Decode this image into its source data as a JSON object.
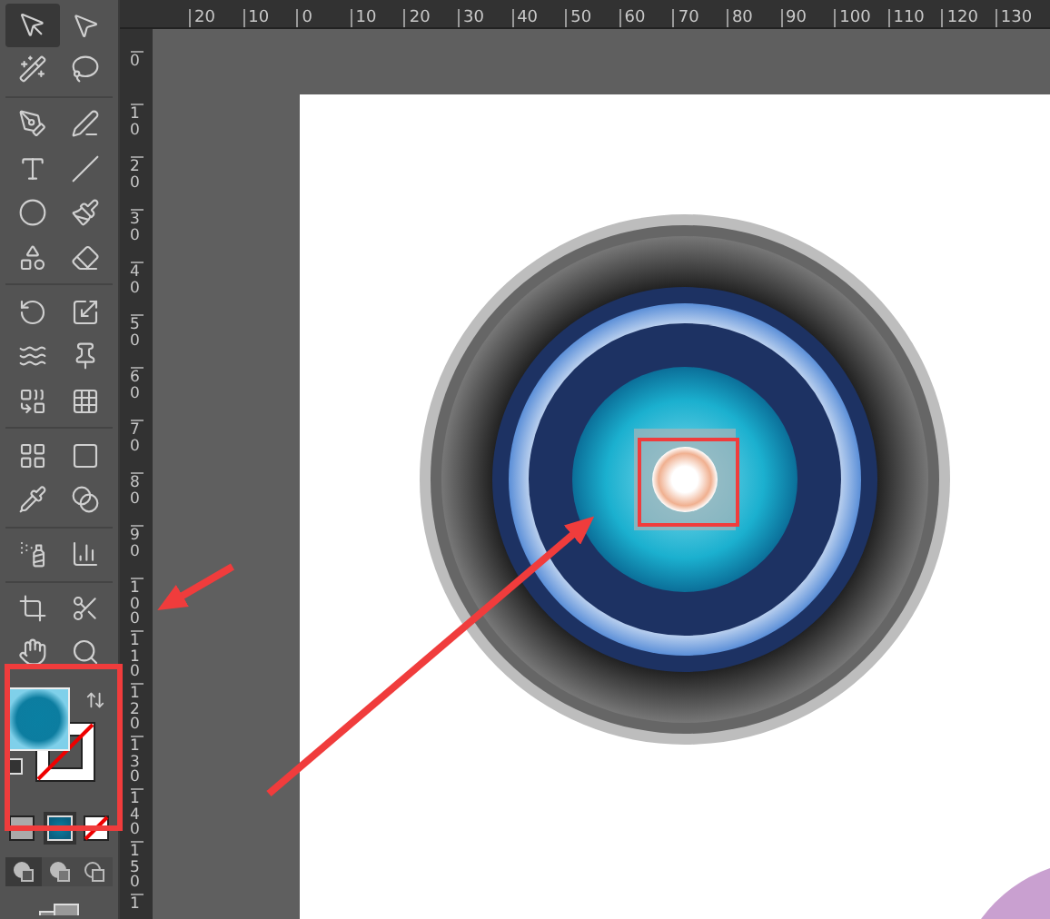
{
  "tools": [
    {
      "kind": "selection",
      "selected": true
    },
    {
      "kind": "direct-selection",
      "selected": false
    },
    {
      "kind": "magic-wand",
      "selected": false
    },
    {
      "kind": "lasso",
      "selected": false
    },
    {
      "kind": "pen",
      "selected": false
    },
    {
      "kind": "curvature",
      "selected": false
    },
    {
      "kind": "type",
      "selected": false
    },
    {
      "kind": "line",
      "selected": false
    },
    {
      "kind": "ellipse",
      "selected": false
    },
    {
      "kind": "brush",
      "selected": false
    },
    {
      "kind": "shaper",
      "selected": false
    },
    {
      "kind": "eraser",
      "selected": false
    },
    {
      "kind": "rotate",
      "selected": false
    },
    {
      "kind": "scale",
      "selected": false
    },
    {
      "kind": "warp",
      "selected": false
    },
    {
      "kind": "pin",
      "selected": false
    },
    {
      "kind": "shape-builder",
      "selected": false
    },
    {
      "kind": "perspective",
      "selected": false
    },
    {
      "kind": "mesh",
      "selected": false
    },
    {
      "kind": "gradient",
      "selected": false
    },
    {
      "kind": "eyedropper",
      "selected": false
    },
    {
      "kind": "blend",
      "selected": false
    },
    {
      "kind": "sprayer",
      "selected": false
    },
    {
      "kind": "graph",
      "selected": false
    },
    {
      "kind": "artboard",
      "selected": false
    },
    {
      "kind": "knife",
      "selected": false
    },
    {
      "kind": "hand",
      "selected": false
    },
    {
      "kind": "zoom",
      "selected": false
    }
  ],
  "color_modes": [
    {
      "kind": "color",
      "selected": false
    },
    {
      "kind": "gradient",
      "selected": true
    },
    {
      "kind": "none",
      "selected": false
    }
  ],
  "draw_modes": [
    {
      "kind": "normal",
      "selected": true
    },
    {
      "kind": "behind",
      "selected": false
    },
    {
      "kind": "inside",
      "selected": false
    }
  ],
  "top_ruler": {
    "labels": [
      "20",
      "10",
      "0",
      "10",
      "20",
      "30",
      "40",
      "50",
      "60",
      "70",
      "80",
      "90",
      "100",
      "110",
      "120",
      "130"
    ]
  },
  "left_ruler": {
    "labels": [
      "0",
      "10",
      "20",
      "30",
      "40",
      "50",
      "60",
      "70",
      "80",
      "90",
      "100",
      "110",
      "120",
      "130",
      "140",
      "150",
      "1"
    ]
  }
}
